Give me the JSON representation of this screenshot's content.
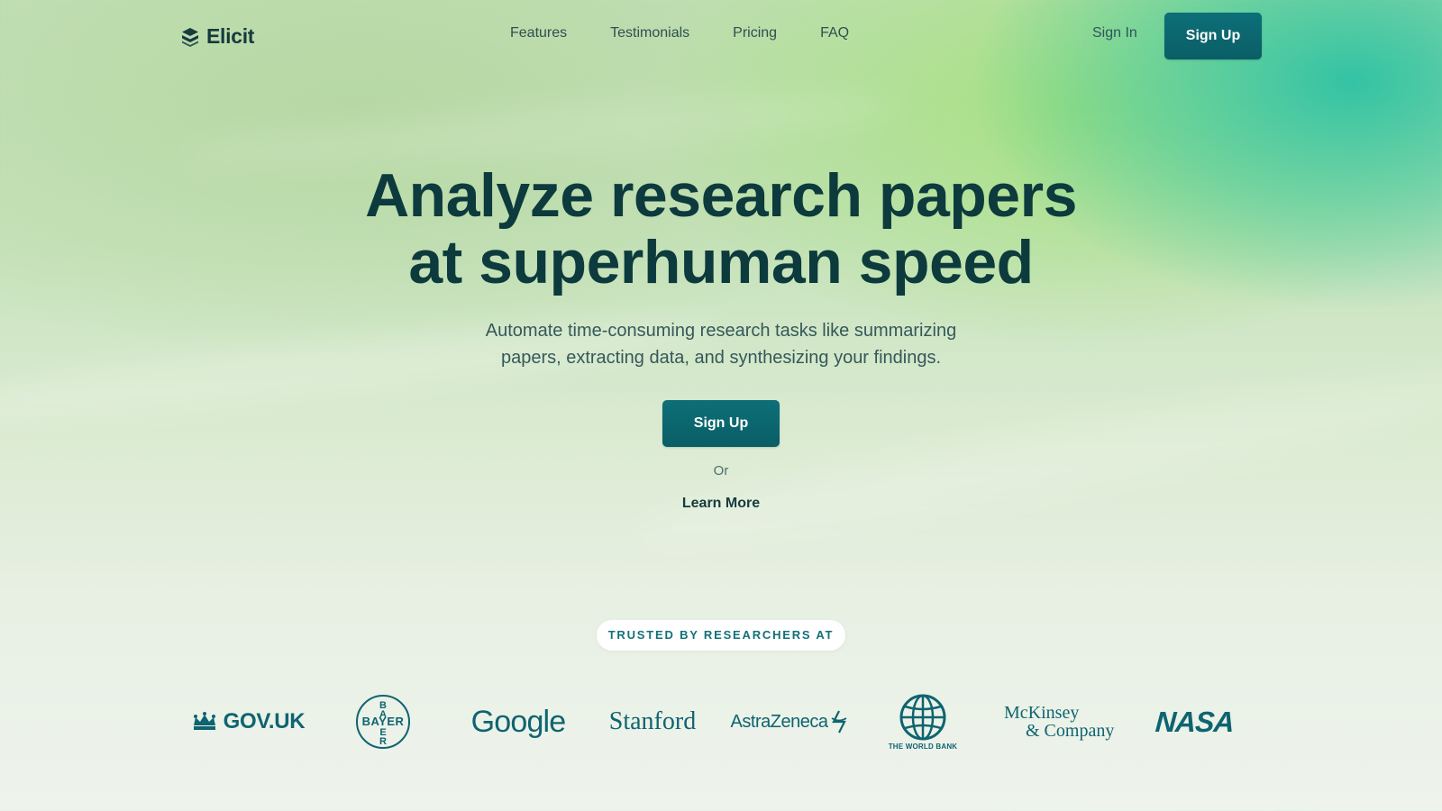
{
  "nav": {
    "brand": "Elicit",
    "links": [
      "Features",
      "Testimonials",
      "Pricing",
      "FAQ"
    ],
    "sign_in": "Sign In",
    "sign_up": "Sign Up"
  },
  "hero": {
    "title_line1": "Analyze research papers",
    "title_line2": "at superhuman speed",
    "subtitle_line1": "Automate time-consuming research tasks like summarizing",
    "subtitle_line2": "papers, extracting data, and synthesizing your findings.",
    "primary_cta": "Sign Up",
    "or_text": "Or",
    "secondary_cta": "Learn More"
  },
  "trusted": {
    "label": "TRUSTED BY RESEARCHERS AT",
    "logos": [
      {
        "name": "GOV.UK",
        "icon": "crown-icon"
      },
      {
        "name": "BAYER",
        "icon": "bayer-cross-icon"
      },
      {
        "name": "Google"
      },
      {
        "name": "Stanford"
      },
      {
        "name": "AstraZeneca",
        "icon": "astrazeneca-icon"
      },
      {
        "name": "THE WORLD BANK",
        "icon": "globe-icon"
      },
      {
        "name": "McKinsey",
        "name2": "& Company"
      },
      {
        "name": "NASA"
      }
    ]
  },
  "colors": {
    "heading": "#0c3a3d",
    "button": "#0a5e66",
    "logo_teal": "#0e6470",
    "accent_green": "#33c3a4"
  }
}
